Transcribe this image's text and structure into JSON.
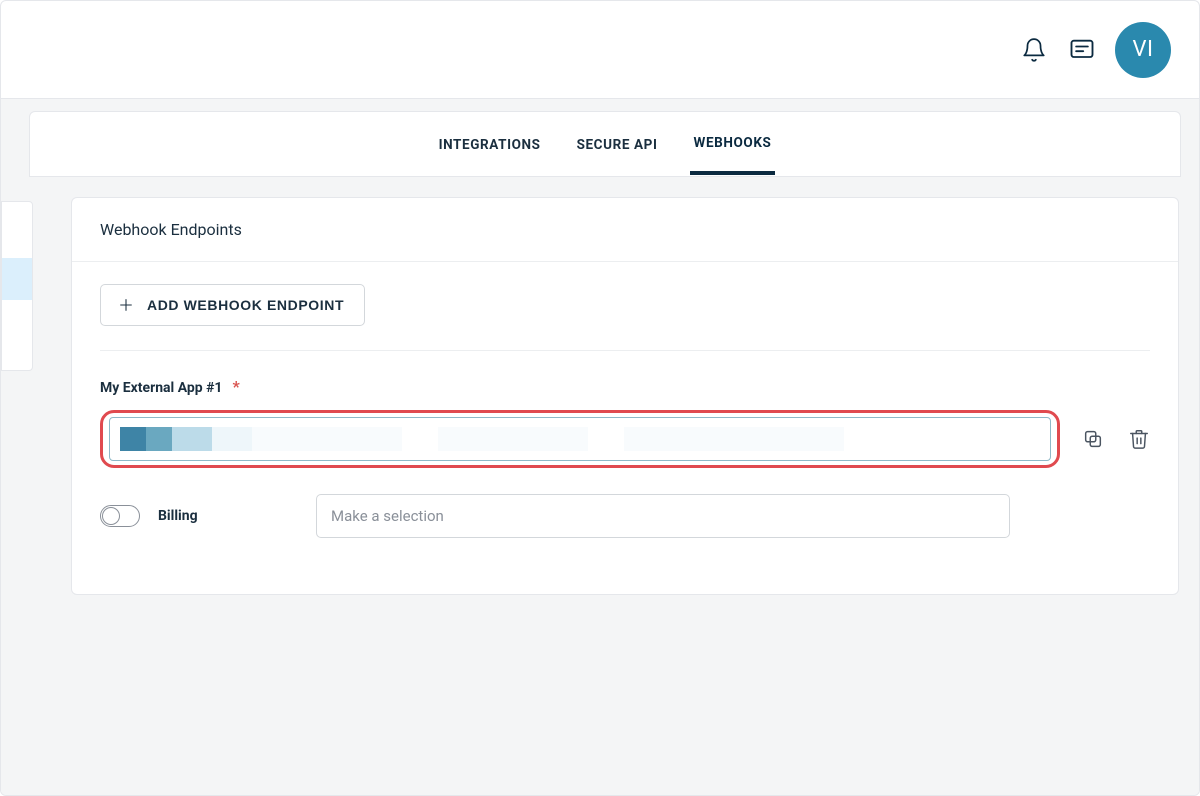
{
  "header": {
    "avatar_initials": "VI"
  },
  "tabs": {
    "integrations": "INTEGRATIONS",
    "secure_api": "SECURE API",
    "webhooks": "WEBHOOKS",
    "active": "webhooks"
  },
  "panel": {
    "title": "Webhook Endpoints",
    "add_button": "ADD WEBHOOK ENDPOINT"
  },
  "endpoint": {
    "label": "My External App #1",
    "required_mark": "*",
    "value_masked": true
  },
  "option": {
    "toggle_on": false,
    "label": "Billing",
    "select_placeholder": "Make a selection"
  },
  "icons": {
    "bell": "notifications-icon",
    "chat": "messages-icon",
    "plus": "plus-icon",
    "copy": "copy-icon",
    "trash": "delete-icon"
  },
  "colors": {
    "accent_dark": "#0b2a40",
    "avatar_bg": "#2a89ae",
    "highlight_border": "#e04a4f"
  }
}
